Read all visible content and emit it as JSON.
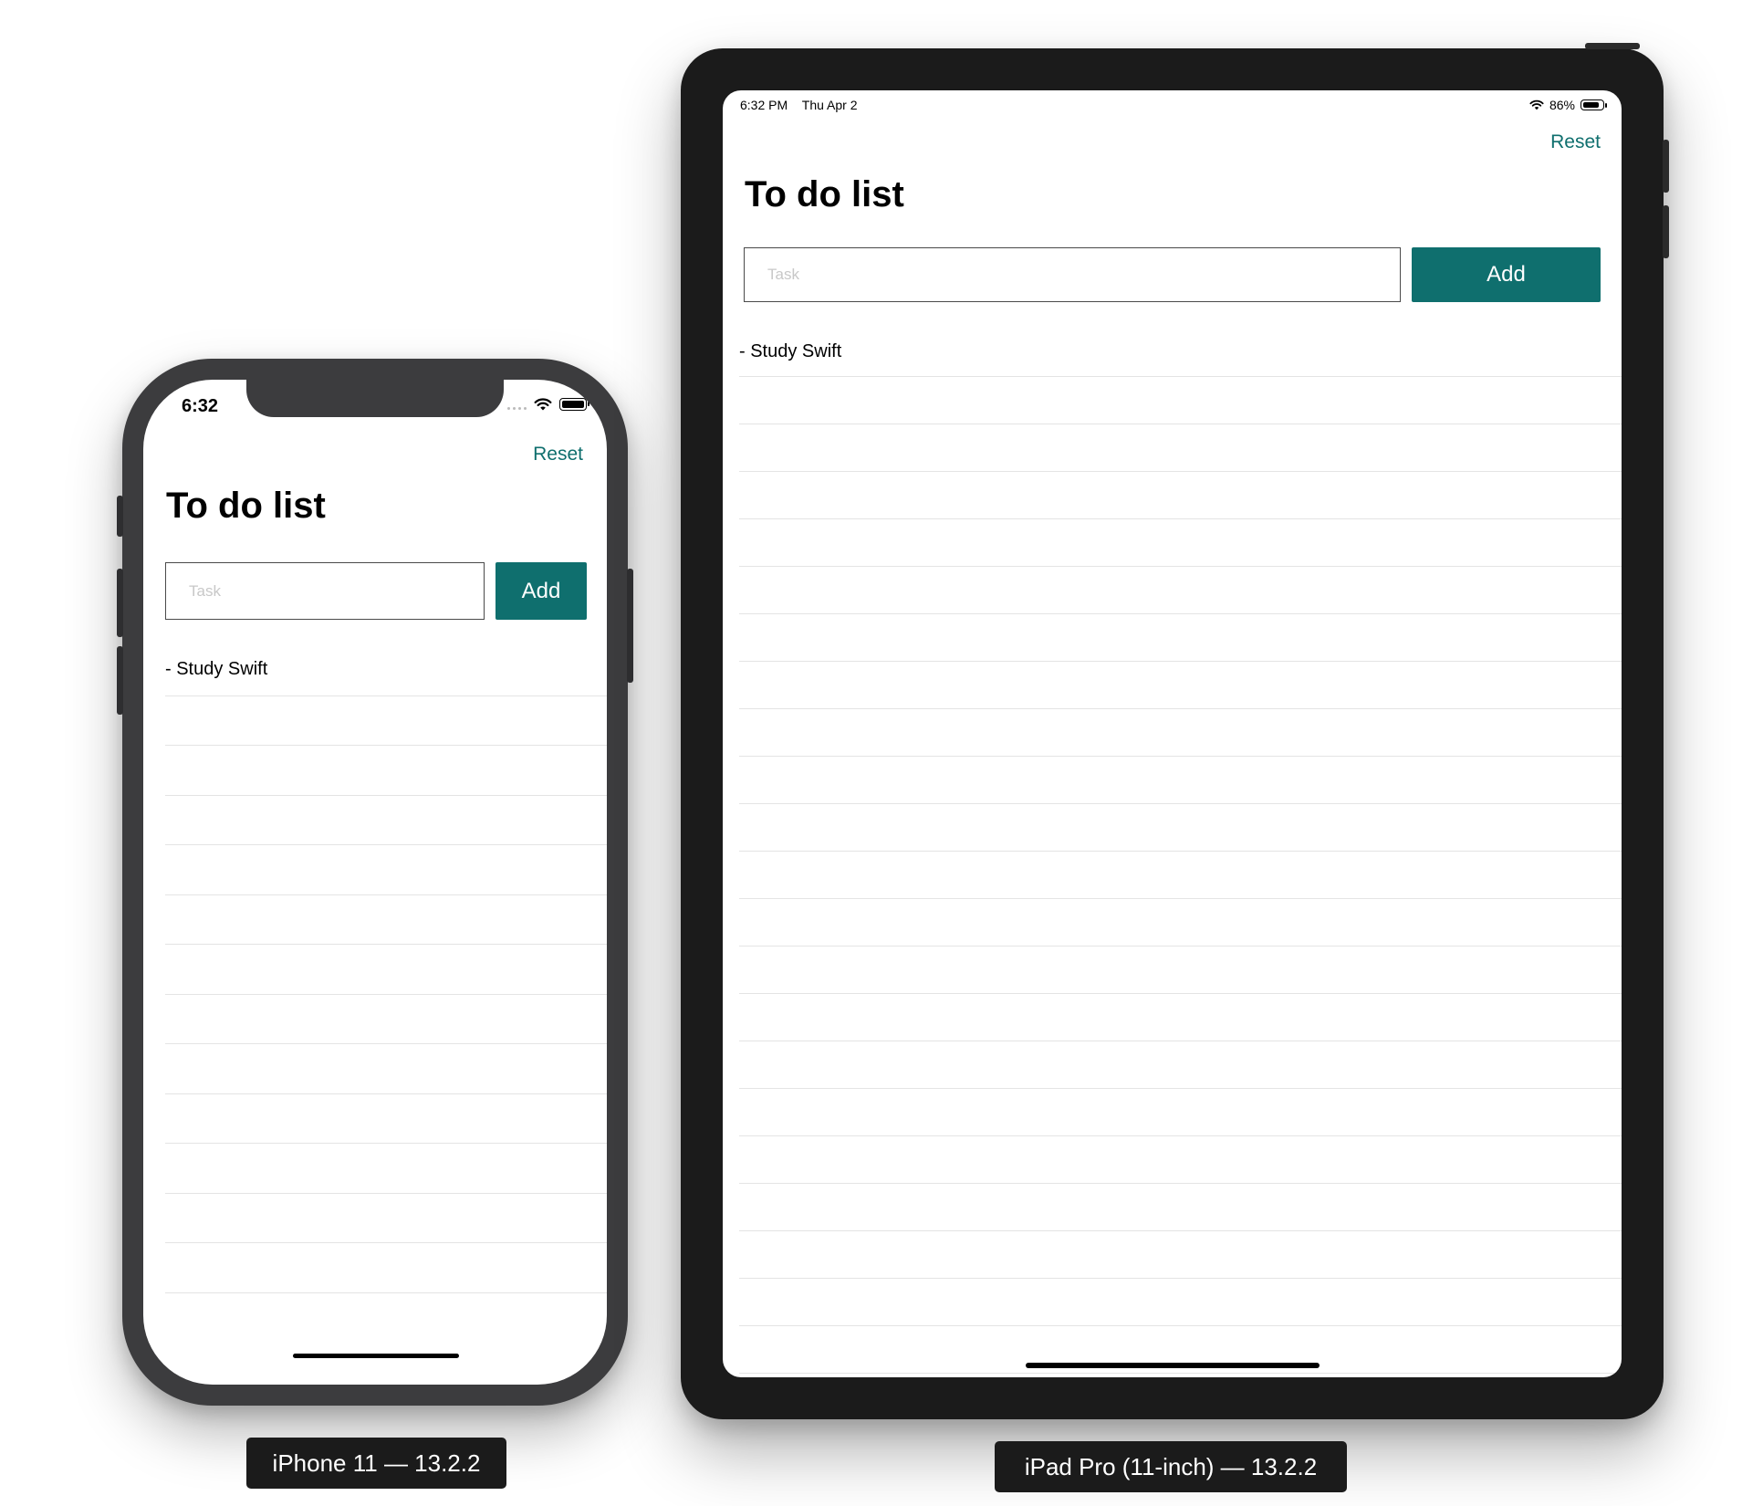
{
  "iphone": {
    "status": {
      "time": "6:32"
    },
    "reset_label": "Reset",
    "title": "To do list",
    "input": {
      "placeholder": "Task",
      "value": ""
    },
    "add_label": "Add",
    "tasks": [
      "- Study Swift"
    ],
    "device_label": "iPhone 11 — 13.2.2"
  },
  "ipad": {
    "status": {
      "time": "6:32 PM",
      "date": "Thu Apr 2",
      "battery": "86%"
    },
    "reset_label": "Reset",
    "title": "To do list",
    "input": {
      "placeholder": "Task",
      "value": ""
    },
    "add_label": "Add",
    "tasks": [
      "- Study Swift"
    ],
    "device_label": "iPad Pro (11-inch) — 13.2.2"
  },
  "colors": {
    "accent": "#0f6f6e",
    "bezel_iphone": "#3c3c3e",
    "bezel_ipad": "#1b1b1b"
  },
  "icons": [
    "wifi-icon",
    "battery-icon",
    "cellular-signal-icon"
  ]
}
